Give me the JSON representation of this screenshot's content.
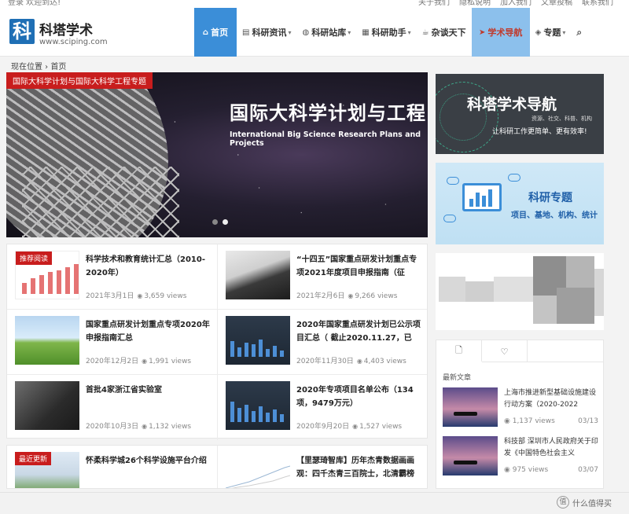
{
  "top_strip": {
    "left": "登录 欢迎到达!",
    "right": [
      "关于我们",
      "隐私说明",
      "加入我们",
      "文章投稿",
      "联系我们"
    ]
  },
  "header": {
    "logo_char": "科",
    "site_name": "科塔学术",
    "site_url": "www.sciping.com",
    "nav": [
      {
        "label": "首页",
        "icon": "home-icon",
        "glyph": "⌂",
        "state": "active",
        "dropdown": false
      },
      {
        "label": "科研资讯",
        "icon": "document-icon",
        "glyph": "▤",
        "state": "normal",
        "dropdown": true
      },
      {
        "label": "科研站库",
        "icon": "globe-icon",
        "glyph": "◍",
        "state": "normal",
        "dropdown": true
      },
      {
        "label": "科研助手",
        "icon": "grid-icon",
        "glyph": "▦",
        "state": "normal",
        "dropdown": true
      },
      {
        "label": "杂谈天下",
        "icon": "coffee-icon",
        "glyph": "☕",
        "state": "normal",
        "dropdown": false
      },
      {
        "label": "学术导航",
        "icon": "paper-plane-icon",
        "glyph": "➤",
        "state": "highlight",
        "dropdown": false
      },
      {
        "label": "专题",
        "icon": "layers-icon",
        "glyph": "◈",
        "state": "normal",
        "dropdown": true
      }
    ],
    "search_glyph": "⌕"
  },
  "breadcrumb": "现在位置 › 首页",
  "banner": {
    "tag": "国际大科学计划与国际大科学工程专题",
    "title_cn": "国际大科学计划与工程",
    "title_en": "International Big Science Research Plans and Projects"
  },
  "articles": [
    {
      "title": "科学技术和教育统计汇总（2010-2020年）",
      "date": "2021年3月1日",
      "views": "3,659 views",
      "badge": "推荐阅读",
      "thumb": "chart"
    },
    {
      "title": "“十四五”国家重点研发计划重点专项2021年度项目申报指南（征",
      "date": "2021年2月6日",
      "views": "9,266 views",
      "badge": "",
      "thumb": "photo"
    },
    {
      "title": "国家重点研发计划重点专项2020年申报指南汇总",
      "date": "2020年12月2日",
      "views": "1,991 views",
      "badge": "",
      "thumb": "grass"
    },
    {
      "title": "2020年国家重点研发计划已公示项目汇总（ 截止2020.11.27，已",
      "date": "2020年11月30日",
      "views": "4,403 views",
      "badge": "",
      "thumb": "dark"
    },
    {
      "title": "首批4家浙江省实验室",
      "date": "2020年10月3日",
      "views": "1,132 views",
      "badge": "",
      "thumb": "hand"
    },
    {
      "title": "2020年专项项目名单公布（134项，9479万元）",
      "date": "2020年9月20日",
      "views": "1,527 views",
      "badge": "",
      "thumb": "dark"
    }
  ],
  "latest_row": [
    {
      "title": "怀柔科学城26个科学设施平台介绍",
      "badge": "最近更新"
    },
    {
      "title": "【里瑟琦智库】历年杰青数据画画观：四千杰青三百院士，北清霸榜",
      "badge": ""
    }
  ],
  "sidebar": {
    "ad1": {
      "title": "科塔学术导航",
      "sub1": "资源、社交、科普、机构",
      "sub2": "让科研工作更简单、更有效率!"
    },
    "ad2": {
      "title": "科研专题",
      "sub": "项目、基地、机构、统计"
    },
    "tabs": [
      {
        "glyph": "🗋",
        "icon": "document-icon"
      },
      {
        "glyph": "♡",
        "icon": "heart-icon"
      }
    ],
    "section_title": "最新文章",
    "posts": [
      {
        "title": "上海市推进新型基础设施建设行动方案（2020-2022",
        "views": "1,137 views",
        "date": "03/13"
      },
      {
        "title": "科技部 深圳市人民政府关于印发《中国特色社会主义",
        "views": "975 views",
        "date": "03/07"
      }
    ]
  },
  "watermark": {
    "glyph": "值",
    "text": "什么值得买"
  }
}
